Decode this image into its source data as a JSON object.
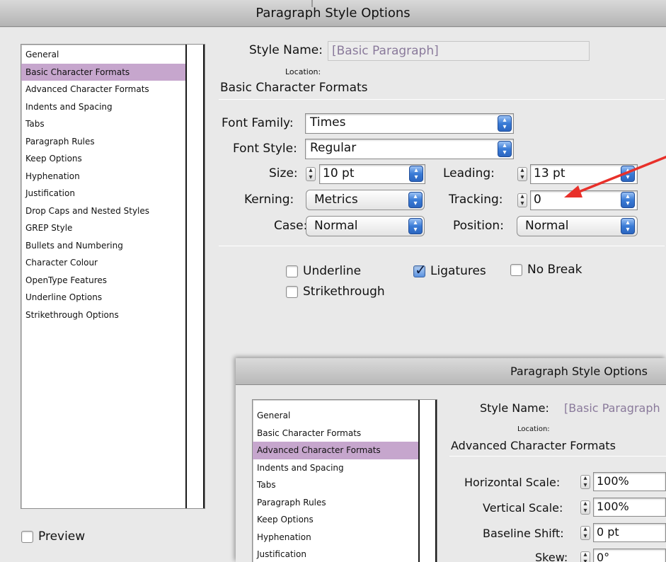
{
  "main": {
    "title": "Paragraph Style Options",
    "categories": [
      "General",
      "Basic Character Formats",
      "Advanced Character Formats",
      "Indents and Spacing",
      "Tabs",
      "Paragraph Rules",
      "Keep Options",
      "Hyphenation",
      "Justification",
      "Drop Caps and Nested Styles",
      "GREP Style",
      "Bullets and Numbering",
      "Character Colour",
      "OpenType Features",
      "Underline Options",
      "Strikethrough Options"
    ],
    "selected_category": "Basic Character Formats",
    "style_name_label": "Style Name:",
    "style_name_value": "[Basic Paragraph]",
    "location_label": "Location:",
    "section_title": "Basic Character Formats",
    "font_family": {
      "label": "Font Family:",
      "value": "Times"
    },
    "font_style": {
      "label": "Font Style:",
      "value": "Regular"
    },
    "size": {
      "label": "Size:",
      "value": "10 pt"
    },
    "leading": {
      "label": "Leading:",
      "value": "13 pt"
    },
    "kerning": {
      "label": "Kerning:",
      "value": "Metrics"
    },
    "tracking": {
      "label": "Tracking:",
      "value": "0"
    },
    "case": {
      "label": "Case:",
      "value": "Normal"
    },
    "position": {
      "label": "Position:",
      "value": "Normal"
    },
    "checkboxes": {
      "underline": {
        "label": "Underline",
        "checked": false
      },
      "ligatures": {
        "label": "Ligatures",
        "checked": true
      },
      "no_break": {
        "label": "No Break",
        "checked": false
      },
      "strikethrough": {
        "label": "Strikethrough",
        "checked": false
      }
    },
    "preview": {
      "label": "Preview",
      "checked": false
    }
  },
  "overlay": {
    "title": "Paragraph Style Options",
    "categories": [
      "General",
      "Basic Character Formats",
      "Advanced Character Formats",
      "Indents and Spacing",
      "Tabs",
      "Paragraph Rules",
      "Keep Options",
      "Hyphenation",
      "Justification"
    ],
    "selected_category": "Advanced Character Formats",
    "style_name_label": "Style Name:",
    "style_name_value": "[Basic Paragraph",
    "location_label": "Location:",
    "section_title": "Advanced Character Formats",
    "horizontal_scale": {
      "label": "Horizontal Scale:",
      "value": "100%"
    },
    "vertical_scale": {
      "label": "Vertical Scale:",
      "value": "100%"
    },
    "baseline_shift": {
      "label": "Baseline Shift:",
      "value": "0 pt"
    },
    "skew": {
      "label": "Skew:",
      "value": "0°"
    }
  },
  "annotation": {
    "color": "#e8302a",
    "icon": "red-arrow"
  },
  "colors": {
    "selection": "#c6a6cd",
    "accent": "#3a7bd6"
  }
}
